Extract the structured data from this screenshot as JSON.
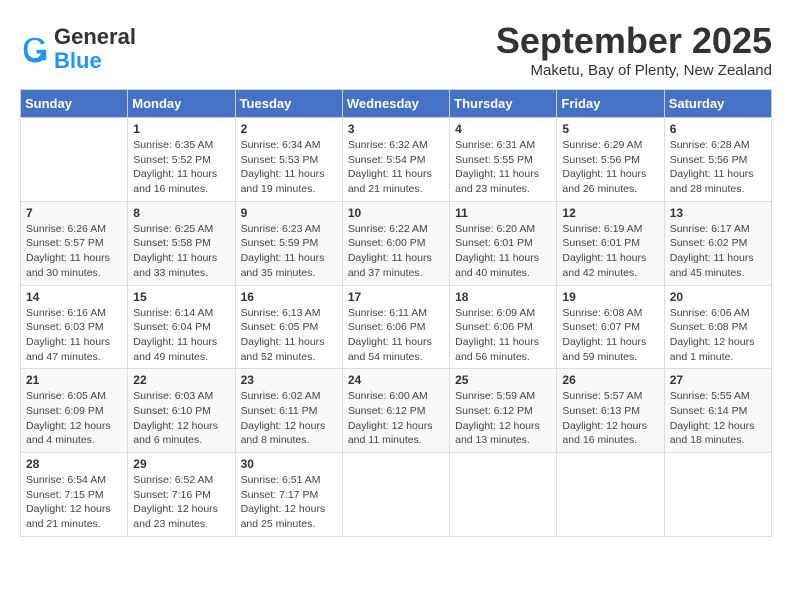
{
  "header": {
    "logo_line1": "General",
    "logo_line2": "Blue",
    "title": "September 2025",
    "subtitle": "Maketu, Bay of Plenty, New Zealand"
  },
  "calendar": {
    "days_of_week": [
      "Sunday",
      "Monday",
      "Tuesday",
      "Wednesday",
      "Thursday",
      "Friday",
      "Saturday"
    ],
    "weeks": [
      [
        {
          "day": "",
          "content": ""
        },
        {
          "day": "1",
          "content": "Sunrise: 6:35 AM\nSunset: 5:52 PM\nDaylight: 11 hours\nand 16 minutes."
        },
        {
          "day": "2",
          "content": "Sunrise: 6:34 AM\nSunset: 5:53 PM\nDaylight: 11 hours\nand 19 minutes."
        },
        {
          "day": "3",
          "content": "Sunrise: 6:32 AM\nSunset: 5:54 PM\nDaylight: 11 hours\nand 21 minutes."
        },
        {
          "day": "4",
          "content": "Sunrise: 6:31 AM\nSunset: 5:55 PM\nDaylight: 11 hours\nand 23 minutes."
        },
        {
          "day": "5",
          "content": "Sunrise: 6:29 AM\nSunset: 5:56 PM\nDaylight: 11 hours\nand 26 minutes."
        },
        {
          "day": "6",
          "content": "Sunrise: 6:28 AM\nSunset: 5:56 PM\nDaylight: 11 hours\nand 28 minutes."
        }
      ],
      [
        {
          "day": "7",
          "content": "Sunrise: 6:26 AM\nSunset: 5:57 PM\nDaylight: 11 hours\nand 30 minutes."
        },
        {
          "day": "8",
          "content": "Sunrise: 6:25 AM\nSunset: 5:58 PM\nDaylight: 11 hours\nand 33 minutes."
        },
        {
          "day": "9",
          "content": "Sunrise: 6:23 AM\nSunset: 5:59 PM\nDaylight: 11 hours\nand 35 minutes."
        },
        {
          "day": "10",
          "content": "Sunrise: 6:22 AM\nSunset: 6:00 PM\nDaylight: 11 hours\nand 37 minutes."
        },
        {
          "day": "11",
          "content": "Sunrise: 6:20 AM\nSunset: 6:01 PM\nDaylight: 11 hours\nand 40 minutes."
        },
        {
          "day": "12",
          "content": "Sunrise: 6:19 AM\nSunset: 6:01 PM\nDaylight: 11 hours\nand 42 minutes."
        },
        {
          "day": "13",
          "content": "Sunrise: 6:17 AM\nSunset: 6:02 PM\nDaylight: 11 hours\nand 45 minutes."
        }
      ],
      [
        {
          "day": "14",
          "content": "Sunrise: 6:16 AM\nSunset: 6:03 PM\nDaylight: 11 hours\nand 47 minutes."
        },
        {
          "day": "15",
          "content": "Sunrise: 6:14 AM\nSunset: 6:04 PM\nDaylight: 11 hours\nand 49 minutes."
        },
        {
          "day": "16",
          "content": "Sunrise: 6:13 AM\nSunset: 6:05 PM\nDaylight: 11 hours\nand 52 minutes."
        },
        {
          "day": "17",
          "content": "Sunrise: 6:11 AM\nSunset: 6:06 PM\nDaylight: 11 hours\nand 54 minutes."
        },
        {
          "day": "18",
          "content": "Sunrise: 6:09 AM\nSunset: 6:06 PM\nDaylight: 11 hours\nand 56 minutes."
        },
        {
          "day": "19",
          "content": "Sunrise: 6:08 AM\nSunset: 6:07 PM\nDaylight: 11 hours\nand 59 minutes."
        },
        {
          "day": "20",
          "content": "Sunrise: 6:06 AM\nSunset: 6:08 PM\nDaylight: 12 hours\nand 1 minute."
        }
      ],
      [
        {
          "day": "21",
          "content": "Sunrise: 6:05 AM\nSunset: 6:09 PM\nDaylight: 12 hours\nand 4 minutes."
        },
        {
          "day": "22",
          "content": "Sunrise: 6:03 AM\nSunset: 6:10 PM\nDaylight: 12 hours\nand 6 minutes."
        },
        {
          "day": "23",
          "content": "Sunrise: 6:02 AM\nSunset: 6:11 PM\nDaylight: 12 hours\nand 8 minutes."
        },
        {
          "day": "24",
          "content": "Sunrise: 6:00 AM\nSunset: 6:12 PM\nDaylight: 12 hours\nand 11 minutes."
        },
        {
          "day": "25",
          "content": "Sunrise: 5:59 AM\nSunset: 6:12 PM\nDaylight: 12 hours\nand 13 minutes."
        },
        {
          "day": "26",
          "content": "Sunrise: 5:57 AM\nSunset: 6:13 PM\nDaylight: 12 hours\nand 16 minutes."
        },
        {
          "day": "27",
          "content": "Sunrise: 5:55 AM\nSunset: 6:14 PM\nDaylight: 12 hours\nand 18 minutes."
        }
      ],
      [
        {
          "day": "28",
          "content": "Sunrise: 6:54 AM\nSunset: 7:15 PM\nDaylight: 12 hours\nand 21 minutes."
        },
        {
          "day": "29",
          "content": "Sunrise: 6:52 AM\nSunset: 7:16 PM\nDaylight: 12 hours\nand 23 minutes."
        },
        {
          "day": "30",
          "content": "Sunrise: 6:51 AM\nSunset: 7:17 PM\nDaylight: 12 hours\nand 25 minutes."
        },
        {
          "day": "",
          "content": ""
        },
        {
          "day": "",
          "content": ""
        },
        {
          "day": "",
          "content": ""
        },
        {
          "day": "",
          "content": ""
        }
      ]
    ]
  }
}
